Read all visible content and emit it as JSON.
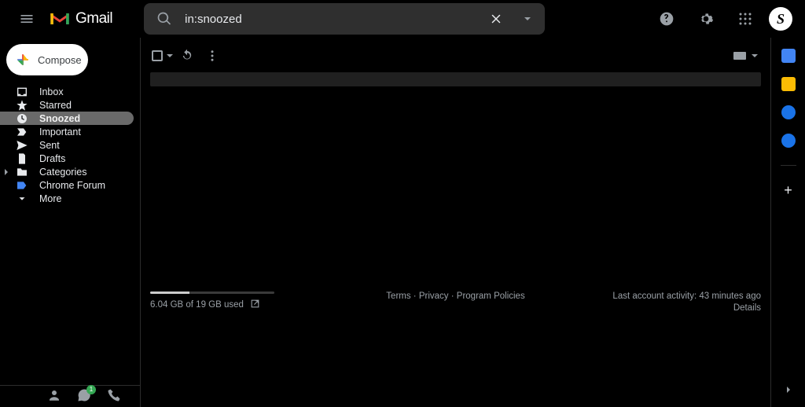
{
  "header": {
    "product_name": "Gmail",
    "avatar_initial": "S"
  },
  "search": {
    "value": "in:snoozed"
  },
  "compose": {
    "label": "Compose"
  },
  "sidebar": {
    "items": [
      {
        "label": "Inbox"
      },
      {
        "label": "Starred"
      },
      {
        "label": "Snoozed"
      },
      {
        "label": "Important"
      },
      {
        "label": "Sent"
      },
      {
        "label": "Drafts"
      },
      {
        "label": "Categories"
      },
      {
        "label": "Chrome Forum"
      },
      {
        "label": "More"
      }
    ],
    "hangouts_badge": "1"
  },
  "footer": {
    "storage_text": "6.04 GB of 19 GB used",
    "storage_percent": 31.8,
    "links": {
      "terms": "Terms",
      "privacy": "Privacy",
      "policies": "Program Policies"
    },
    "activity_line": "Last account activity: 43 minutes ago",
    "details_label": "Details"
  }
}
